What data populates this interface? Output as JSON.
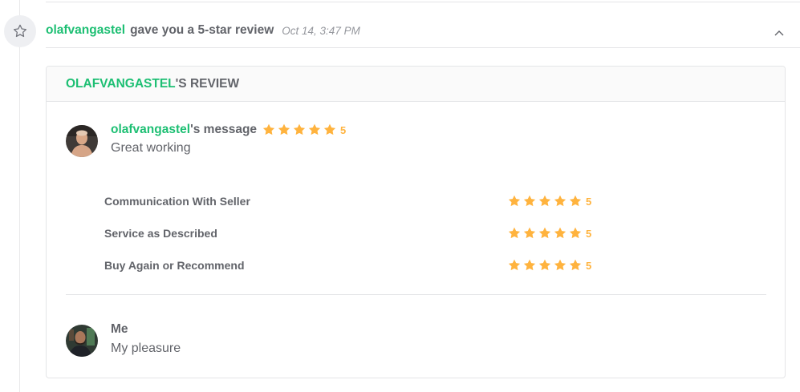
{
  "event": {
    "username": "olafvangastel",
    "text": "gave you a 5-star review",
    "time": "Oct 14, 3:47 PM",
    "icon": "star-outline-icon"
  },
  "card": {
    "title_user": "OLAFVANGASTEL",
    "title_suffix": "'S REVIEW"
  },
  "buyer_message": {
    "username": "olafvangastel",
    "label_suffix": "'s message",
    "rating": 5,
    "rating_text": "5",
    "text": "Great working"
  },
  "criteria": [
    {
      "label": "Communication With Seller",
      "rating": 5,
      "rating_text": "5"
    },
    {
      "label": "Service as Described",
      "rating": 5,
      "rating_text": "5"
    },
    {
      "label": "Buy Again or Recommend",
      "rating": 5,
      "rating_text": "5"
    }
  ],
  "reply": {
    "name": "Me",
    "text": "My pleasure"
  },
  "colors": {
    "accent_green": "#1dbf73",
    "star_orange": "#ffb33e",
    "text_gray": "#62646a",
    "muted_gray": "#95979d"
  }
}
